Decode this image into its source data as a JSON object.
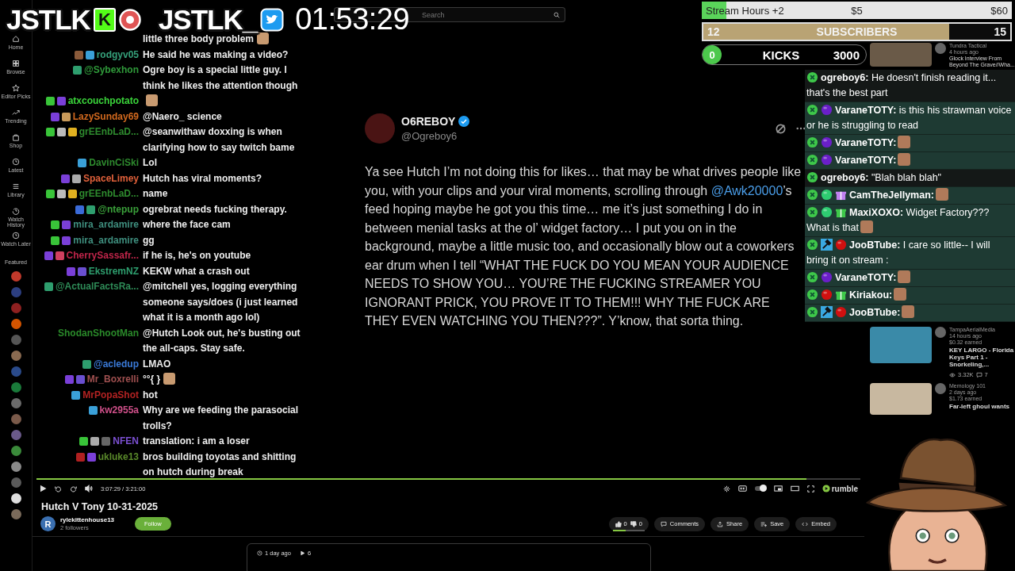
{
  "overlay": {
    "logo_text": "JSTLK",
    "kick_letter": "K",
    "twitter_text": "JSTLK_",
    "timer": "01:53:29"
  },
  "sidebar": {
    "items": [
      {
        "kind": "home",
        "label": "Home"
      },
      {
        "kind": "browse",
        "label": "Browse"
      },
      {
        "kind": "picks",
        "label": "Editor Picks"
      },
      {
        "kind": "trending",
        "label": "Trending"
      },
      {
        "kind": "shop",
        "label": "Shop"
      },
      {
        "kind": "latest",
        "label": "Latest"
      },
      {
        "kind": "library",
        "label": "Library"
      },
      {
        "kind": "history",
        "label": "Watch History"
      },
      {
        "kind": "later",
        "label": "Watch Later"
      }
    ],
    "featured_label": "Featured",
    "channels": [
      {
        "color": "#c0392b"
      },
      {
        "color": "#2c3e80"
      },
      {
        "color": "#8e2020"
      },
      {
        "color": "#d35400"
      },
      {
        "color": "#555555"
      },
      {
        "color": "#8a6a50"
      },
      {
        "color": "#2a4a8a"
      },
      {
        "color": "#1a7a3a"
      },
      {
        "color": "#6a6a6a"
      },
      {
        "color": "#7a5a4a"
      },
      {
        "color": "#6a5a8a"
      },
      {
        "color": "#3a8a3a"
      },
      {
        "color": "#8a8a8a"
      },
      {
        "color": "#5a5a5a"
      },
      {
        "color": "#dddddd"
      },
      {
        "color": "#7a6a5a"
      }
    ]
  },
  "search": {
    "placeholder": "Search"
  },
  "post": {
    "author": "O6REBOY",
    "verified": true,
    "handle": "@Ogreboy6",
    "parts": [
      {
        "kind": "text",
        "text": "Ya see Hutch I’m not doing this for likes… that may be what drives people like you, with your clips and your viral moments, scrolling through "
      },
      {
        "kind": "link",
        "text": "@Awk20000"
      },
      {
        "kind": "text",
        "text": "’s feed hoping maybe he got you this time… me it’s just something I do in between menial tasks at the ol’ widget factory… I put you on in the background, maybe a little music too, and occasionally blow out a coworkers ear drum when I tell “WHAT THE FUCK DO YOU MEAN YOUR AUDIENCE NEEDS TO SHOW YOU… YOU’RE THE FUCKING STREAMER YOU IGNORANT PRICK, YOU PROVE IT TO THEM!!! WHY THE FUCK ARE THEY EVEN WATCHING YOU THEN???”. Y’know, that sorta thing."
      }
    ]
  },
  "player": {
    "progress": {
      "level": 0.935
    },
    "autoplay": {
      "on": true
    },
    "time": "3:07:29 / 3:21:00",
    "brand": "rumble"
  },
  "video": {
    "title": "Hutch V Tony 10-31-2025",
    "channel": {
      "initial": "R",
      "name": "rylekittenhouse13",
      "followers": "2 followers",
      "follow_label": "Follow"
    },
    "likes": "0",
    "dislikes": "0",
    "rating": {
      "level": 0.4
    },
    "actions": [
      {
        "kind": "comments",
        "label": "Comments"
      },
      {
        "kind": "share",
        "label": "Share"
      },
      {
        "kind": "save",
        "label": "Save"
      },
      {
        "kind": "embed",
        "label": "Embed"
      }
    ]
  },
  "description": {
    "age": "1 day ago",
    "views": "6"
  },
  "recommended": [
    {
      "channel": "Tundra Tactical",
      "age": "4 hours ago",
      "title": "Glock Interview From Beyond The Grave//Wha..."
    },
    {
      "channel": "TampaAerialMedia",
      "age": "14 hours ago",
      "earned": "$0.32 earned",
      "title": "KEY LARGO - Florida Keys Part 1 - Snorkeling,...",
      "views": "3.32K",
      "comments": "7"
    },
    {
      "channel": "Memology 101",
      "age": "2 days ago",
      "earned": "$1.73 earned",
      "title": "Far-left ghoul wants"
    }
  ],
  "goals": [
    {
      "kind": "hours",
      "start": "Stream Hours +2",
      "label": "$5",
      "end": "$60",
      "level": 0.08
    },
    {
      "kind": "subs",
      "start": "12",
      "label": "SUBSCRIBERS",
      "end": "15",
      "level": 0.8
    },
    {
      "kind": "kicks",
      "start": "0",
      "label": "KICKS",
      "end": "3000",
      "level": 0
    }
  ],
  "left_chat": [
    {
      "text": "little three body problem",
      "emote": true
    },
    {
      "user": "rodgyv05",
      "color": "#35a07a",
      "badges": [
        {
          "color": "#8a5a3a"
        },
        {
          "color": "#3aa0d8"
        }
      ],
      "text": "He said he was making a video?"
    },
    {
      "user": "@Sybexhon",
      "color": "#2f9a3a",
      "badges": [
        {
          "color": "#2e9e6e"
        }
      ],
      "text": "Ogre boy is a special little guy. I think he likes the attention though"
    },
    {
      "user": "atxcouchpotato",
      "color": "#3ad43a",
      "badges": [
        {
          "color": "#39c439"
        },
        {
          "color": "#7a3fd8"
        }
      ],
      "emote": true
    },
    {
      "user": "LazySunday69",
      "color": "#d2691e",
      "badges": [
        {
          "color": "#7a3fd8"
        },
        {
          "color": "#c89a5a"
        }
      ],
      "text": "@Naero_ science"
    },
    {
      "user": "grEEnbLaD...",
      "color": "#2e8b2e",
      "badges": [
        {
          "color": "#39c439"
        },
        {
          "color": "#bbbbbb"
        },
        {
          "color": "#e0b020"
        }
      ],
      "text": "@seanwithaw doxxing is when clarifying how to say twitch bame"
    },
    {
      "user": "DavinCiSki",
      "color": "#2e8b2e",
      "badges": [
        {
          "color": "#3aa0d8"
        }
      ],
      "text": "Lol"
    },
    {
      "user": "SpaceLimey",
      "color": "#e0603a",
      "badges": [
        {
          "color": "#7a3fd8"
        },
        {
          "color": "#aaaaaa"
        }
      ],
      "text": "Hutch has viral moments?"
    },
    {
      "user": "grEEnbLaD...",
      "color": "#2e8b2e",
      "badges": [
        {
          "color": "#39c439"
        },
        {
          "color": "#bbbbbb"
        },
        {
          "color": "#e0b020"
        }
      ],
      "text": "name"
    },
    {
      "user": "@ntepup",
      "color": "#3aa03a",
      "badges": [
        {
          "color": "#3a6ad8"
        },
        {
          "color": "#2e9e6e"
        }
      ],
      "text": "ogrebrat needs fucking therapy."
    },
    {
      "user": "mira_ardamire",
      "color": "#3f8f7f",
      "badges": [
        {
          "color": "#39c439"
        },
        {
          "color": "#7a3fd8"
        }
      ],
      "text": "where the face cam"
    },
    {
      "user": "mira_ardamire",
      "color": "#3f8f7f",
      "badges": [
        {
          "color": "#39c439"
        },
        {
          "color": "#7a3fd8"
        }
      ],
      "text": "gg"
    },
    {
      "user": "CherrySassafr...",
      "color": "#c0254a",
      "badges": [
        {
          "color": "#7a3fd8"
        },
        {
          "color": "#d04060"
        }
      ],
      "text": "if he is, he's on youtube"
    },
    {
      "user": "EkstremNZ",
      "color": "#2e9e6e",
      "badges": [
        {
          "color": "#7a3fd8"
        },
        {
          "color": "#6a4fd0"
        }
      ],
      "text": "KEKW what a crash out"
    },
    {
      "user": "@ActualFactsRa...",
      "color": "#2e8b57",
      "badges": [
        {
          "color": "#2e9e6e"
        }
      ],
      "text": "@mitchell yes, logging everything someone says/does (i just learned what it is a month ago lol)"
    },
    {
      "user": "ShodanShootMan",
      "color": "#2a8a2a",
      "text": "@Hutch Look out, he's busting out the all-caps. Stay safe."
    },
    {
      "user": "@acledup",
      "color": "#3a7ad8",
      "badges": [
        {
          "color": "#2e9e6e"
        }
      ],
      "text": "LMAO"
    },
    {
      "user": "Mr_Boxrelli",
      "color": "#a05050",
      "badges": [
        {
          "color": "#7a3fd8"
        },
        {
          "color": "#6a4fd0"
        }
      ],
      "text": "°°{ }",
      "emote": true
    },
    {
      "user": "MrPopaShot",
      "color": "#b22222",
      "badges": [
        {
          "color": "#3aa0d8"
        }
      ],
      "text": "hot"
    },
    {
      "user": "kw2955a",
      "color": "#d0508a",
      "badges": [
        {
          "color": "#3aa0d8"
        }
      ],
      "text": "Why are we feeding the parasocial trolls?"
    },
    {
      "user": "NFEN",
      "color": "#7a4fd0",
      "badges": [
        {
          "color": "#39c439"
        },
        {
          "color": "#aaaaaa"
        },
        {
          "color": "#666666"
        }
      ],
      "text": "translation: i am a loser"
    },
    {
      "user": "ukluke13",
      "color": "#5a8a2a",
      "badges": [
        {
          "color": "#b02020"
        },
        {
          "color": "#7a3fd8"
        }
      ],
      "text": "bros building toyotas and shitting on hutch during break"
    }
  ],
  "right_chat": [
    {
      "highlighted": true,
      "badges": [
        {
          "kind": "mod",
          "color": "#3ec84a"
        }
      ],
      "user": "ogreboy6:",
      "text": "He doesn't finish reading it... that's the best part"
    },
    {
      "highlighted": false,
      "badges": [
        {
          "kind": "mod",
          "color": "#3ec84a"
        },
        {
          "kind": "orb",
          "color": "#6a1fc8"
        }
      ],
      "user": "VaraneTOTY:",
      "text": "is this his strawman voice or he is struggling to read"
    },
    {
      "highlighted": false,
      "badges": [
        {
          "kind": "mod",
          "color": "#3ec84a"
        },
        {
          "kind": "orb",
          "color": "#6a1fc8"
        }
      ],
      "user": "VaraneTOTY:",
      "emote": true
    },
    {
      "highlighted": false,
      "badges": [
        {
          "kind": "mod",
          "color": "#3ec84a"
        },
        {
          "kind": "orb",
          "color": "#6a1fc8"
        }
      ],
      "user": "VaraneTOTY:",
      "emote": true
    },
    {
      "highlighted": true,
      "badges": [
        {
          "kind": "mod",
          "color": "#3ec84a"
        }
      ],
      "user": "ogreboy6:",
      "text": "\"Blah blah blah\""
    },
    {
      "highlighted": false,
      "badges": [
        {
          "kind": "mod",
          "color": "#3ec84a"
        },
        {
          "kind": "orb",
          "color": "#2ecc71"
        },
        {
          "kind": "gift",
          "color": "#c080f0"
        }
      ],
      "user": "CamTheJellyman:",
      "emote": true
    },
    {
      "highlighted": false,
      "badges": [
        {
          "kind": "mod",
          "color": "#3ec84a"
        },
        {
          "kind": "orb",
          "color": "#2ecc71"
        },
        {
          "kind": "gift",
          "color": "#3ec84a"
        }
      ],
      "user": "MaxiXOXO:",
      "text": "Widget Factory??? What is that",
      "emote": true
    },
    {
      "highlighted": false,
      "badges": [
        {
          "kind": "mod",
          "color": "#3ec84a"
        },
        {
          "kind": "hammer",
          "color": "#3aa8e0"
        },
        {
          "kind": "orb",
          "color": "#d01010"
        }
      ],
      "user": "JooBTube:",
      "text": "I care so little-- I will bring it on stream :"
    },
    {
      "highlighted": false,
      "badges": [
        {
          "kind": "mod",
          "color": "#3ec84a"
        },
        {
          "kind": "orb",
          "color": "#6a1fc8"
        }
      ],
      "user": "VaraneTOTY:",
      "emote": true
    },
    {
      "highlighted": false,
      "badges": [
        {
          "kind": "mod",
          "color": "#3ec84a"
        },
        {
          "kind": "orb",
          "color": "#d01010"
        },
        {
          "kind": "gift",
          "color": "#3ec84a"
        }
      ],
      "user": "Kiriakou:",
      "emote": true
    },
    {
      "highlighted": false,
      "badges": [
        {
          "kind": "mod",
          "color": "#3ec84a"
        },
        {
          "kind": "hammer",
          "color": "#3aa8e0"
        },
        {
          "kind": "orb",
          "color": "#d01010"
        }
      ],
      "user": "JooBTube:",
      "emote": true
    }
  ]
}
